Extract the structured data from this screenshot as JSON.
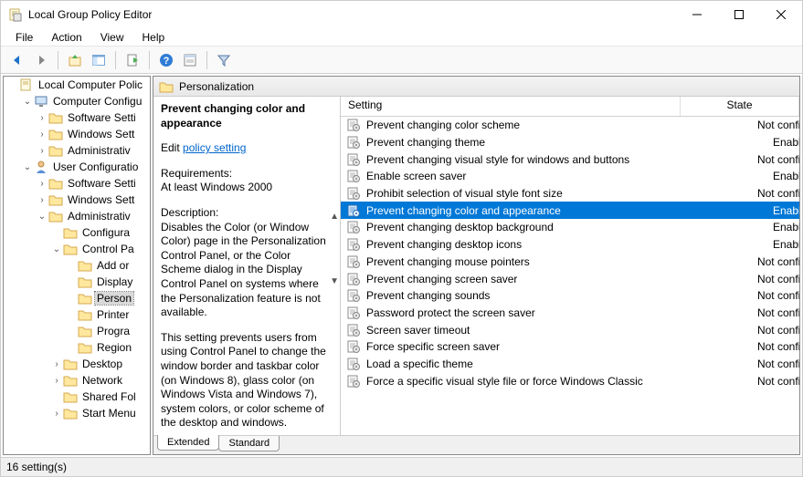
{
  "window": {
    "title": "Local Group Policy Editor"
  },
  "menus": {
    "file": "File",
    "action": "Action",
    "view": "View",
    "help": "Help"
  },
  "tree": {
    "root": "Local Computer Polic",
    "computer_config": "Computer Configu",
    "cc_software": "Software Setti",
    "cc_windows": "Windows Sett",
    "cc_admin": "Administrativ",
    "user_config": "User Configuratio",
    "uc_software": "Software Setti",
    "uc_windows": "Windows Sett",
    "uc_admin": "Administrativ",
    "uc_admin_configura": "Configura",
    "uc_admin_controlpa": "Control Pa",
    "cp_addor": "Add or",
    "cp_display": "Display",
    "cp_person": "Person",
    "cp_printer": "Printer",
    "cp_progra": "Progra",
    "cp_region": "Region",
    "uc_desktop": "Desktop",
    "uc_network": "Network",
    "uc_sharedfol": "Shared Fol",
    "uc_startmenu": "Start Menu"
  },
  "right": {
    "header": "Personalization",
    "desc_title": "Prevent changing color and appearance",
    "edit_label": "Edit",
    "policy_link": "policy setting",
    "req_label": "Requirements:",
    "req_val": "At least Windows 2000",
    "desc_label": "Description:",
    "desc_body": "Disables the Color (or Window Color) page in the Personalization Control Panel, or the Color Scheme dialog in the Display Control Panel on systems where the Personalization feature is not available.",
    "desc_body2": "This setting prevents users from using Control Panel to change the window border and taskbar color (on Windows 8), glass color (on Windows Vista and Windows 7), system colors, or color scheme of the desktop and windows."
  },
  "columns": {
    "setting": "Setting",
    "state": "State"
  },
  "settings": [
    {
      "name": "Prevent changing color scheme",
      "state": "Not configured"
    },
    {
      "name": "Prevent changing theme",
      "state": "Enabled"
    },
    {
      "name": "Prevent changing visual style for windows and buttons",
      "state": "Not configured"
    },
    {
      "name": "Enable screen saver",
      "state": "Enabled"
    },
    {
      "name": "Prohibit selection of visual style font size",
      "state": "Not configured"
    },
    {
      "name": "Prevent changing color and appearance",
      "state": "Enabled",
      "selected": true
    },
    {
      "name": "Prevent changing desktop background",
      "state": "Enabled"
    },
    {
      "name": "Prevent changing desktop icons",
      "state": "Enabled"
    },
    {
      "name": "Prevent changing mouse pointers",
      "state": "Not configured"
    },
    {
      "name": "Prevent changing screen saver",
      "state": "Not configured"
    },
    {
      "name": "Prevent changing sounds",
      "state": "Not configured"
    },
    {
      "name": "Password protect the screen saver",
      "state": "Not configured"
    },
    {
      "name": "Screen saver timeout",
      "state": "Not configured"
    },
    {
      "name": "Force specific screen saver",
      "state": "Not configured"
    },
    {
      "name": "Load a specific theme",
      "state": "Not configured"
    },
    {
      "name": "Force a specific visual style file or force Windows Classic",
      "state": "Not configured"
    }
  ],
  "tabs": {
    "extended": "Extended",
    "standard": "Standard"
  },
  "status": "16 setting(s)"
}
